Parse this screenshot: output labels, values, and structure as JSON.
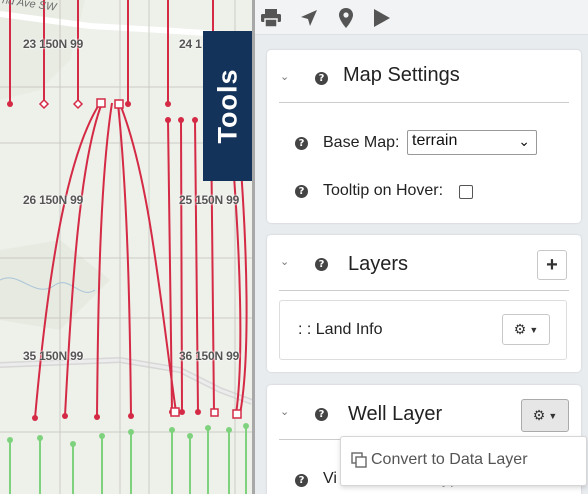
{
  "map": {
    "road_label": "nd Ave SW",
    "township_labels": [
      "23 150N 99",
      "24 1",
      "26 150N 99",
      "25 150N 99",
      "35 150N 99",
      "36 150N 99"
    ]
  },
  "tools_tab": {
    "label": "Tools"
  },
  "toolbar": {
    "icons": [
      "print-icon",
      "navigate-arrow-icon",
      "map-marker-icon",
      "play-icon"
    ]
  },
  "map_settings": {
    "title": "Map Settings",
    "base_map_label": "Base Map:",
    "base_map_value": "terrain",
    "tooltip_label": "Tooltip on Hover:",
    "tooltip_checked": false
  },
  "layers": {
    "title": "Layers",
    "add_label": "+",
    "items": [
      {
        "label": ": : Land Info"
      }
    ]
  },
  "well_layer": {
    "title": "Well Layer",
    "visible_row_label": "Vi",
    "visible_row_tail": "yp",
    "menu": {
      "convert_label": "Convert to Data Layer"
    }
  },
  "colors": {
    "tools_tab_bg": "#14335a",
    "well_red": "#d42a45",
    "well_green": "#7ed27e"
  }
}
